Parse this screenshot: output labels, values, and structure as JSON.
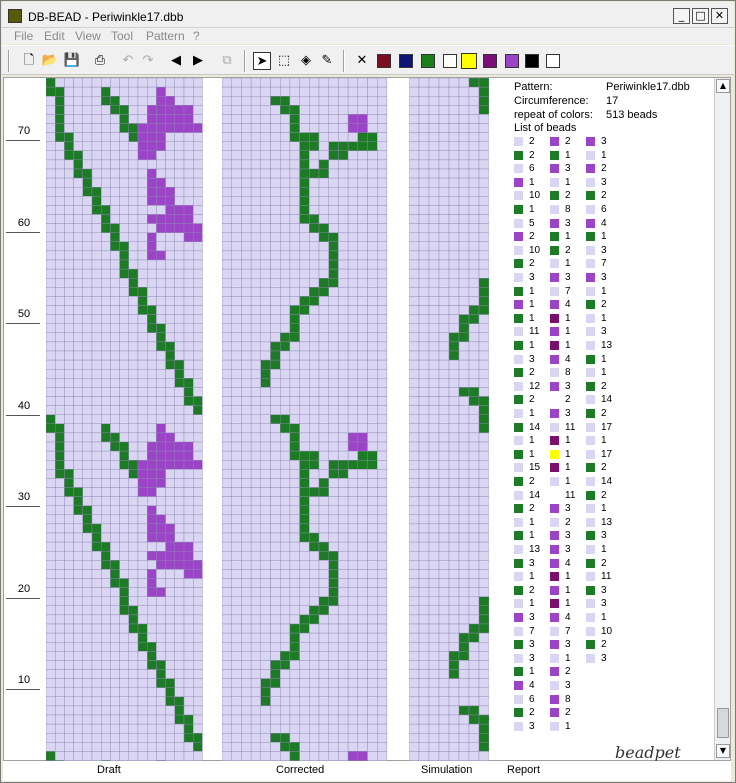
{
  "app": {
    "title": "DB-BEAD - Periwinkle17.dbb",
    "logo": "beadpet"
  },
  "menu": [
    "File",
    "Edit",
    "View",
    "Tool",
    "Pattern",
    "?"
  ],
  "toolbar": {
    "icons": [
      "new-file-icon",
      "open-folder-icon",
      "save-icon",
      "print-icon",
      "undo-icon",
      "redo-icon",
      "arrow-left-icon",
      "arrow-right-icon",
      "copy-icon",
      "pointer-icon",
      "select-rect-icon",
      "fill-icon",
      "eyedropper-icon",
      "delete-icon"
    ],
    "swatches": [
      "#7b0f20",
      "#0e1475",
      "#1d7f18",
      "#ffffff",
      "#ffff00",
      "#7a0f7a",
      "#9b44c8",
      "#000000",
      "#ffffff"
    ]
  },
  "pattern": {
    "rows": "OOOOOOOOOOOOOOOOO|OOOOOOOOOOOOOOOOO|OOOOOGGOOOOOOOOOO|OOOOOOGGOOOOOOOOO|OOOOOOOGOOOOOPPOO|OOOOOOOGOOOOOPPOO|OOOOOOOGGGOOOOGGO|OOOOOOOOGGOGGGGGO|OOOOOOOOGOOGGOOOO|OOOOOOOOGOGOOOOOO|OOOOOOOOGGGOOOOOO|OOOOOOOOGOOOOOOOO|OOOOOOOOGOOOOOOOO|OOOOOOOOGOOOOOOOO|OOOOOOOOGOOOOOOOO|OOOOOOOOGGOOOOOOO|OOOOOOOOOGGOOOOOO|OOOOOOOOOOGGOOOOO|OOOOOOOOOOOGOOOOO|OOOOOOOOOOOGOOOOO|OOOOOOOOOOOGOOOOO|OOOOOOOOOOOGOOOOO|OOOOOOOOOOGGOOOOO|OOOOOOOOOGGOOOOOO|OOOOOOOOGGOOOOOOO|OOOOOOOGGOOOOOOOO|OOOOOOOGOOOOOOOOO|OOOOOOOGOOOOOOOOO|OOOOOOGGOOOOOOOOO|OOOOOGGOOOOOOOOOO|OOOOOGOOOOOOOOOOO|OOOOGGOOOOOOOOOOO|OOOOGOOOOOOOOOOOO|OOOOGOOOOOOOOOOOO|OOOOOOOOOOOOOOOOO"
  },
  "draft": {
    "rows": "GOOOOOOOOOOOOOOOO|GGOOOOGOOOOOPOOOO|OGOOOOGGOOOOPPOOO|OGOOOOOGGOOPPPPPO|OGOOOOOOGOOPPPPPO|OGOOOOOOGGPPPPPPP|OGGOOOOOOGPPPOOOO|OOGOOOOOOOPPPOOOO|OOGGOOOOOOPPOOOOO|OOOGOOOOOOOOOOOOO|OOOGGOOOOOOPOOOOO|OOOOGOOOOOOPPOOOO|OOOOGGOOOOOPPPOOO|OOOOOGOOOOOPPPOOO|OOOOOGGOOOOOOPPPO|OOOOOOGOOOOPPPPPO|OOOOOOGGOOOOPPPPP|OOOOOOOGOOOPOOOPP|OOOOOOOGGOOPOOOOO|OOOOOOOOGOOPPOOOO|OOOOOOOOGOOOOOOOO|OOOOOOOOGGOOOOOOO|OOOOOOOOOGOOOOOOO|OOOOOOOOOGGOOOOOO|OOOOOOOOOOGOOOOOO|OOOOOOOOOOGGOOOOO|OOOOOOOOOOOGOOOOO|OOOOOOOOOOOGGOOOO|OOOOOOOOOOOOGOOOO|OOOOOOOOOOOOGGOOO|OOOOOOOOOOOOOGOOO|OOOOOOOOOOOOOGGOO|OOOOOOOOOOOOOOGOO|OOOOOOOOOOOOOOGGO|OOOOOOOOOOOOOOOGO|OOOOOOOOOOOOOOOGG|OOOOOOOOOOOOOOOOG"
  },
  "info": {
    "pattern_label": "Pattern:",
    "pattern_value": "Periwinkle17.dbb",
    "circ_label": "Circumference:",
    "circ_value": "17",
    "repeat_label": "repeat of colors:",
    "repeat_value": "513 beads",
    "list_label": "List of beads"
  },
  "bead_list": {
    "col1": [
      [
        "O",
        "2"
      ],
      [
        "G",
        "2"
      ],
      [
        "O",
        "6"
      ],
      [
        "P",
        "1"
      ],
      [
        "O",
        "10"
      ],
      [
        "G",
        "1"
      ],
      [
        "O",
        "5"
      ],
      [
        "P",
        "2"
      ],
      [
        "O",
        "10"
      ],
      [
        "G",
        "2"
      ],
      [
        "O",
        "3"
      ],
      [
        "G",
        "1"
      ],
      [
        "P",
        "1"
      ],
      [
        "G",
        "1"
      ],
      [
        "O",
        "11"
      ],
      [
        "G",
        "1"
      ],
      [
        "O",
        "3"
      ],
      [
        "G",
        "2"
      ],
      [
        "O",
        "12"
      ],
      [
        "G",
        "2"
      ],
      [
        "O",
        "1"
      ],
      [
        "G",
        "14"
      ],
      [
        "O",
        "1"
      ],
      [
        "G",
        "1"
      ],
      [
        "O",
        "15"
      ],
      [
        "G",
        "2"
      ],
      [
        "O",
        "14"
      ],
      [
        "G",
        "2"
      ],
      [
        "O",
        "1"
      ],
      [
        "G",
        "1"
      ],
      [
        "O",
        "13"
      ],
      [
        "G",
        "3"
      ],
      [
        "O",
        "1"
      ],
      [
        "G",
        "2"
      ],
      [
        "O",
        "1"
      ],
      [
        "P",
        "3"
      ],
      [
        "O",
        "7"
      ],
      [
        "G",
        "3"
      ],
      [
        "O",
        "3"
      ],
      [
        "G",
        "1"
      ],
      [
        "P",
        "4"
      ],
      [
        "O",
        "6"
      ],
      [
        "G",
        "2"
      ],
      [
        "O",
        "3"
      ]
    ],
    "col2": [
      [
        "P",
        "2"
      ],
      [
        "G",
        "1"
      ],
      [
        "P",
        "3"
      ],
      [
        "O",
        "1"
      ],
      [
        "G",
        "2"
      ],
      [
        "O",
        "8"
      ],
      [
        "P",
        "3"
      ],
      [
        "G",
        "1"
      ],
      [
        "G",
        "2"
      ],
      [
        "O",
        "1"
      ],
      [
        "P",
        "3"
      ],
      [
        "O",
        "7"
      ],
      [
        "P",
        "4"
      ],
      [
        "M",
        "1"
      ],
      [
        "P",
        "1"
      ],
      [
        "M",
        "1"
      ],
      [
        "P",
        "4"
      ],
      [
        "O",
        "8"
      ],
      [
        "P",
        "3"
      ],
      [
        "W",
        "2"
      ],
      [
        "P",
        "3"
      ],
      [
        "O",
        "11"
      ],
      [
        "M",
        "1"
      ],
      [
        "Y",
        "1"
      ],
      [
        "M",
        "1"
      ],
      [
        "O",
        "1"
      ],
      [
        "W",
        "11"
      ],
      [
        "P",
        "3"
      ],
      [
        "O",
        "2"
      ],
      [
        "P",
        "3"
      ],
      [
        "P",
        "3"
      ],
      [
        "P",
        "4"
      ],
      [
        "M",
        "1"
      ],
      [
        "P",
        "1"
      ],
      [
        "M",
        "1"
      ],
      [
        "P",
        "4"
      ],
      [
        "O",
        "7"
      ],
      [
        "P",
        "3"
      ],
      [
        "O",
        "1"
      ],
      [
        "P",
        "2"
      ],
      [
        "O",
        "3"
      ],
      [
        "P",
        "8"
      ],
      [
        "P",
        "2"
      ],
      [
        "O",
        "1"
      ]
    ],
    "col3": [
      [
        "P",
        "3"
      ],
      [
        "O",
        "1"
      ],
      [
        "P",
        "2"
      ],
      [
        "O",
        "3"
      ],
      [
        "G",
        "2"
      ],
      [
        "O",
        "6"
      ],
      [
        "P",
        "4"
      ],
      [
        "G",
        "1"
      ],
      [
        "O",
        "3"
      ],
      [
        "O",
        "7"
      ],
      [
        "P",
        "3"
      ],
      [
        "O",
        "1"
      ],
      [
        "G",
        "2"
      ],
      [
        "O",
        "1"
      ],
      [
        "O",
        "3"
      ],
      [
        "O",
        "13"
      ],
      [
        "G",
        "1"
      ],
      [
        "O",
        "1"
      ],
      [
        "G",
        "2"
      ],
      [
        "O",
        "14"
      ],
      [
        "G",
        "2"
      ],
      [
        "O",
        "17"
      ],
      [
        "O",
        "1"
      ],
      [
        "O",
        "17"
      ],
      [
        "G",
        "2"
      ],
      [
        "O",
        "14"
      ],
      [
        "G",
        "2"
      ],
      [
        "O",
        "1"
      ],
      [
        "O",
        "13"
      ],
      [
        "G",
        "3"
      ],
      [
        "O",
        "1"
      ],
      [
        "G",
        "2"
      ],
      [
        "O",
        "11"
      ],
      [
        "G",
        "3"
      ],
      [
        "O",
        "3"
      ],
      [
        "O",
        "1"
      ],
      [
        "O",
        "10"
      ],
      [
        "G",
        "2"
      ],
      [
        "O",
        "3"
      ]
    ]
  },
  "colors": {
    "O": "#d9d5f2",
    "G": "#1d7b25",
    "P": "#9b44c8",
    "M": "#7a0f6c",
    "W": "#ffffff",
    "Y": "#ffff00"
  },
  "yaxis": [
    "70",
    "60",
    "50",
    "40",
    "30",
    "20",
    "10"
  ],
  "panels": {
    "draft_label": "Draft",
    "corrected_label": "Corrected",
    "simulation_label": "Simulation",
    "report_label": "Report"
  }
}
